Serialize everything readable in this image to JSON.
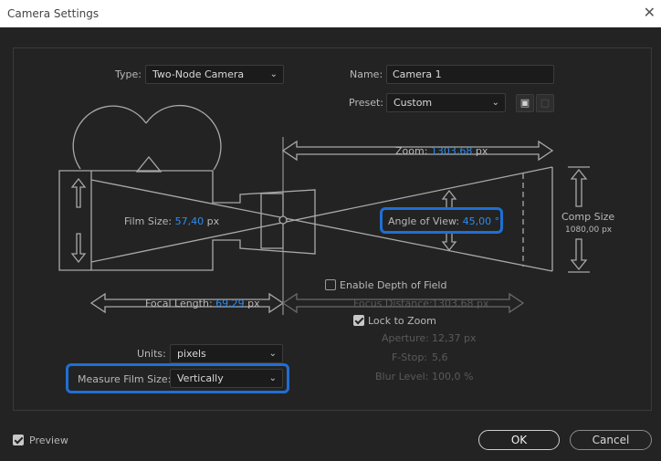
{
  "window": {
    "title": "Camera Settings",
    "close_glyph": "✕"
  },
  "type": {
    "label": "Type:",
    "value": "Two-Node Camera"
  },
  "name": {
    "label": "Name:",
    "value": "Camera 1"
  },
  "preset": {
    "label": "Preset:",
    "value": "Custom"
  },
  "zoom": {
    "label": "Zoom:",
    "value": "1303,68",
    "unit": "px"
  },
  "film_size": {
    "label": "Film Size:",
    "value": "57,40",
    "unit": "px"
  },
  "angle_of_view": {
    "label": "Angle of View:",
    "value": "45,00",
    "unit": "°"
  },
  "comp_size": {
    "label": "Comp Size",
    "value": "1080,00 px"
  },
  "focal_length": {
    "label": "Focal Length:",
    "value": "69,29",
    "unit": "px"
  },
  "depth_of_field": {
    "enable_label": "Enable Depth of Field",
    "focus_distance_label": "Focus Distance:",
    "focus_distance_value": "1303,68 px",
    "lock_to_zoom_label": "Lock to Zoom",
    "aperture_label": "Aperture:",
    "aperture_value": "12,37 px",
    "fstop_label": "F-Stop:",
    "fstop_value": "5,6",
    "blur_label": "Blur Level:",
    "blur_value": "100,0 %"
  },
  "units": {
    "label": "Units:",
    "value": "pixels"
  },
  "measure_film_size": {
    "label": "Measure Film Size:",
    "value": "Vertically"
  },
  "footer": {
    "preview_label": "Preview",
    "ok_label": "OK",
    "cancel_label": "Cancel"
  },
  "icons": {
    "chevron": "chevron-down-icon",
    "save_preset": "save-preset-icon",
    "delete_preset": "trash-icon"
  },
  "colors": {
    "accent": "#2d8ceb",
    "highlight": "#1f6fd4"
  }
}
